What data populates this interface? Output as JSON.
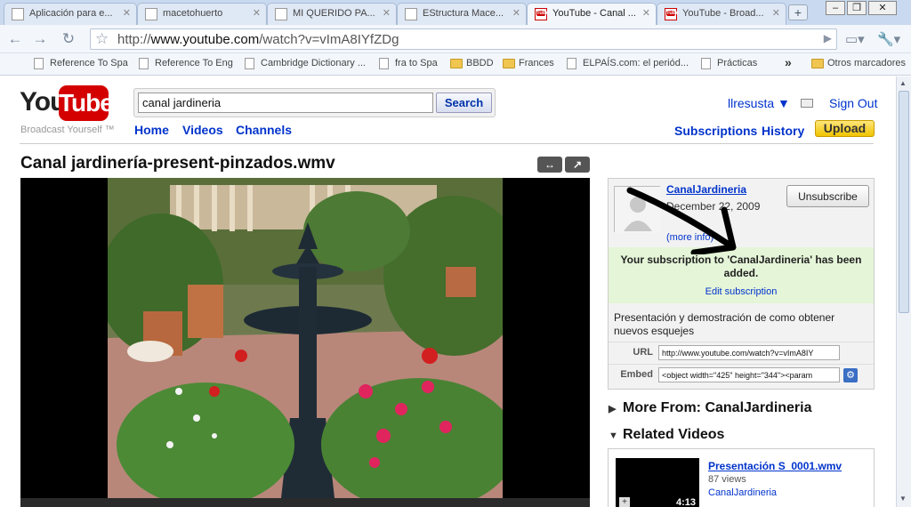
{
  "browser": {
    "tabs": [
      {
        "title": "Aplicación para e...",
        "favicon": "document-icon"
      },
      {
        "title": "macetohuerto",
        "favicon": "document-icon"
      },
      {
        "title": "MI QUERIDO PA...",
        "favicon": "document-icon"
      },
      {
        "title": "EStructura Mace...",
        "favicon": "document-icon"
      },
      {
        "title": "YouTube - Canal ...",
        "favicon": "youtube-icon",
        "active": true
      },
      {
        "title": "YouTube - Broad...",
        "favicon": "youtube-icon"
      }
    ],
    "address": {
      "prefix": "http://",
      "host": "www.youtube.com",
      "path": "/watch?v=vImA8IYfZDg"
    },
    "bookmarks": [
      {
        "label": "Reference To Spa",
        "type": "page"
      },
      {
        "label": "Reference To Eng",
        "type": "page"
      },
      {
        "label": "Cambridge Dictionary ...",
        "type": "page"
      },
      {
        "label": "fra to Spa",
        "type": "page"
      },
      {
        "label": "BBDD",
        "type": "folder"
      },
      {
        "label": "Frances",
        "type": "folder"
      },
      {
        "label": "ELPAÍS.com: el periód...",
        "type": "page"
      },
      {
        "label": "Prácticas",
        "type": "page"
      }
    ],
    "other_bookmarks": "Otros marcadores",
    "more_symbol": "»"
  },
  "youtube": {
    "logo_you": "You",
    "logo_tube": "Tube",
    "tagline": "Broadcast Yourself ™",
    "search": {
      "value": "canal jardineria",
      "button": "Search"
    },
    "nav": [
      "Home",
      "Videos",
      "Channels"
    ],
    "user": {
      "name": "llresusta",
      "sign_out": "Sign Out"
    },
    "links": {
      "subscriptions": "Subscriptions",
      "history": "History",
      "upload": "Upload"
    }
  },
  "video": {
    "title": "Canal jardinería-present-pinzados.wmv"
  },
  "channel": {
    "name": "CanalJardineria",
    "date": "December 22, 2009",
    "more_info": "(more info)",
    "unsubscribe": "Unsubscribe",
    "message": "Your subscription to 'CanalJardineria' has been added.",
    "edit_subscription": "Edit subscription",
    "description": "Presentación y demostración de como obtener nuevos esquejes",
    "url_label": "URL",
    "url_value": "http://www.youtube.com/watch?v=vImA8IY",
    "embed_label": "Embed",
    "embed_value": "<object width=\"425\" height=\"344\"><param"
  },
  "sidebar": {
    "more_from": "More From: CanalJardineria",
    "related": "Related Videos",
    "related_items": [
      {
        "title": "Presentación S_0001.wmv",
        "views": "87 views",
        "channel": "CanalJardineria",
        "duration": "4:13"
      }
    ]
  },
  "colors": {
    "link": "#0033cc",
    "logo_red": "#d40000",
    "upload_yellow": "#f0c400",
    "success_green": "#e5f5d8"
  }
}
